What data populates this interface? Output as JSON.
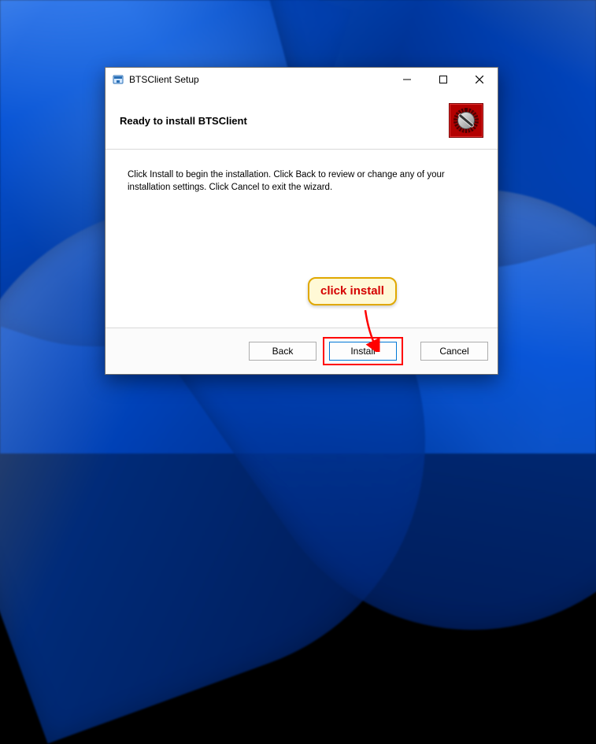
{
  "window": {
    "title": "BTSClient Setup"
  },
  "header": {
    "heading": "Ready to install BTSClient"
  },
  "body": {
    "instruction": "Click Install to begin the installation. Click Back to review or change any of your installation settings. Click Cancel to exit the wizard."
  },
  "footer": {
    "back_label": "Back",
    "install_label": "Install",
    "cancel_label": "Cancel"
  },
  "annotation": {
    "callout_text": "click install",
    "highlight_color": "#ff0000"
  }
}
